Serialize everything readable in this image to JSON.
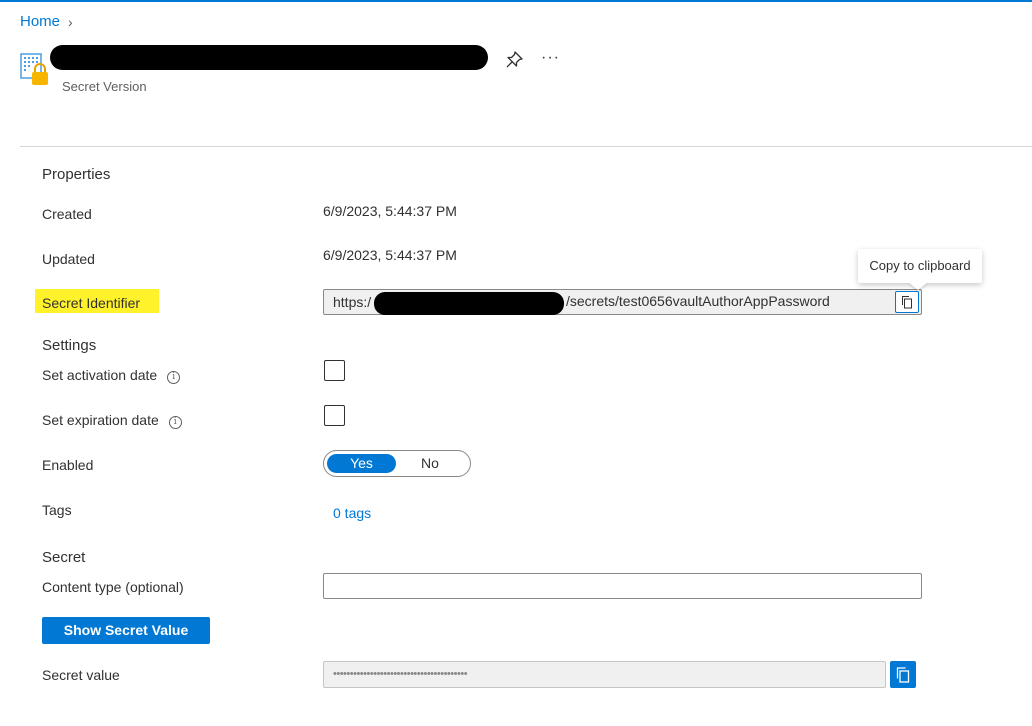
{
  "breadcrumb": {
    "home": "Home",
    "separator": "›"
  },
  "header": {
    "subtitle": "Secret Version",
    "more": "···"
  },
  "properties": {
    "section_title": "Properties",
    "created_label": "Created",
    "created_value": "6/9/2023, 5:44:37 PM",
    "updated_label": "Updated",
    "updated_value": "6/9/2023, 5:44:37 PM",
    "identifier_label": "Secret Identifier",
    "identifier_prefix": "https:/",
    "identifier_suffix": "/secrets/test0656vaultAuthorAppPassword",
    "tooltip": "Copy to clipboard"
  },
  "settings": {
    "section_title": "Settings",
    "activation_label": "Set activation date",
    "expiration_label": "Set expiration date",
    "info_glyph": "i",
    "enabled_label": "Enabled",
    "toggle_yes": "Yes",
    "toggle_no": "No",
    "enabled_value": "Yes",
    "tags_label": "Tags",
    "tags_value": "0 tags"
  },
  "secret": {
    "section_title": "Secret",
    "content_type_label": "Content type (optional)",
    "content_type_value": "",
    "show_button": "Show Secret Value",
    "value_label": "Secret value",
    "masked_value": "••••••••••••••••••••••••••••••••••••••••"
  },
  "colors": {
    "accent": "#0078d4",
    "highlight": "#fff22a"
  }
}
